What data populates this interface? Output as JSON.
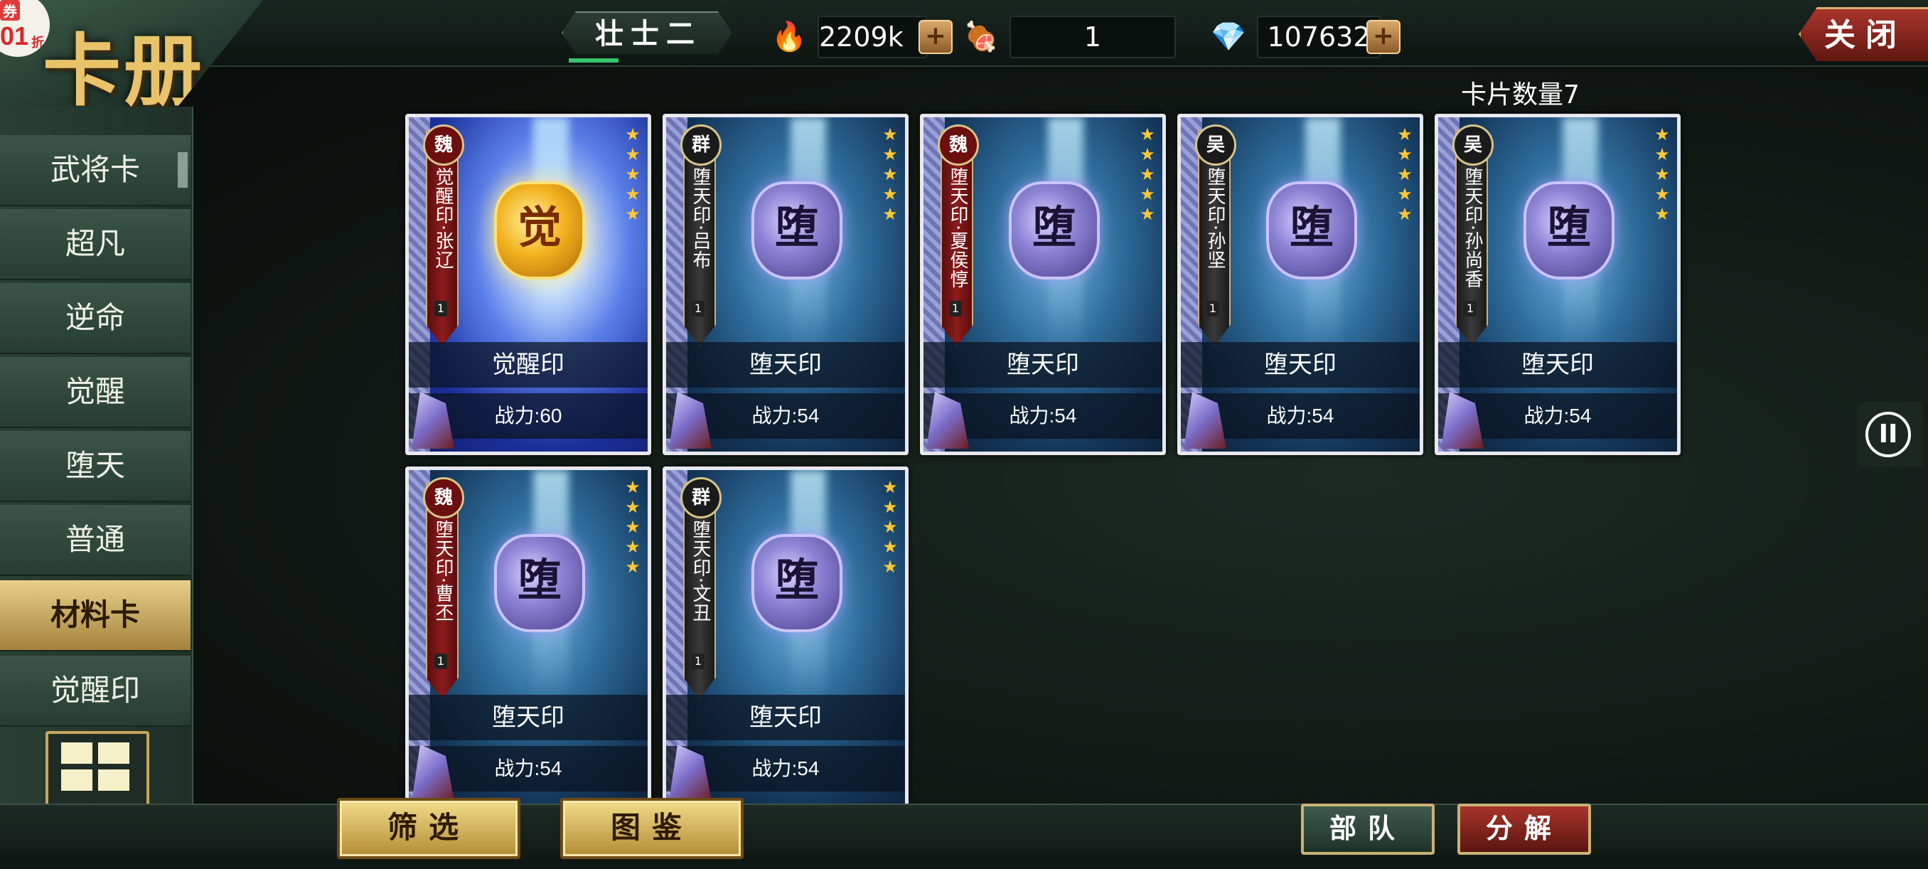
{
  "header": {
    "title": "卡册",
    "coupon": {
      "tag": "券",
      "value": "01",
      "unit": "折"
    },
    "squad_name": "壮士二",
    "resources": [
      {
        "icon": "flame-icon",
        "value": "2209k",
        "has_plus": true
      },
      {
        "icon": "meat-icon",
        "value": "1",
        "has_plus": false
      },
      {
        "icon": "gem-icon",
        "value": "107632",
        "has_plus": true
      }
    ],
    "close_label": "关闭"
  },
  "sidebar": {
    "items": [
      {
        "label": "武将卡",
        "active": false
      },
      {
        "label": "超凡",
        "active": false
      },
      {
        "label": "逆命",
        "active": false
      },
      {
        "label": "觉醒",
        "active": false
      },
      {
        "label": "堕天",
        "active": false
      },
      {
        "label": "普通",
        "active": false
      },
      {
        "label": "材料卡",
        "active": true
      },
      {
        "label": "觉醒印",
        "active": false
      }
    ]
  },
  "card_count": "卡片数量7",
  "cards": [
    {
      "faction": "魏",
      "name": "觉醒印·张辽",
      "level": "1",
      "stars": 5,
      "emblem": "觉",
      "type": "觉醒印",
      "power": "战力:60",
      "style": "gold"
    },
    {
      "faction": "群",
      "name": "堕天印·吕布",
      "level": "1",
      "stars": 5,
      "emblem": "堕",
      "type": "堕天印",
      "power": "战力:54",
      "style": "dark"
    },
    {
      "faction": "魏",
      "name": "堕天印·夏侯惇",
      "level": "1",
      "stars": 5,
      "emblem": "堕",
      "type": "堕天印",
      "power": "战力:54",
      "style": "red"
    },
    {
      "faction": "吴",
      "name": "堕天印·孙坚",
      "level": "1",
      "stars": 5,
      "emblem": "堕",
      "type": "堕天印",
      "power": "战力:54",
      "style": "dark"
    },
    {
      "faction": "吴",
      "name": "堕天印·孙尚香",
      "level": "1",
      "stars": 5,
      "emblem": "堕",
      "type": "堕天印",
      "power": "战力:54",
      "style": "dark"
    },
    {
      "faction": "魏",
      "name": "堕天印·曹丕",
      "level": "1",
      "stars": 5,
      "emblem": "堕",
      "type": "堕天印",
      "power": "战力:54",
      "style": "red"
    },
    {
      "faction": "群",
      "name": "堕天印·文丑",
      "level": "1",
      "stars": 5,
      "emblem": "堕",
      "type": "堕天印",
      "power": "战力:54",
      "style": "dark"
    }
  ],
  "bottom": {
    "filter_label": "筛选",
    "catalog_label": "图鉴",
    "troops_label": "部队",
    "decompose_label": "分解"
  },
  "pause_symbol": "II"
}
